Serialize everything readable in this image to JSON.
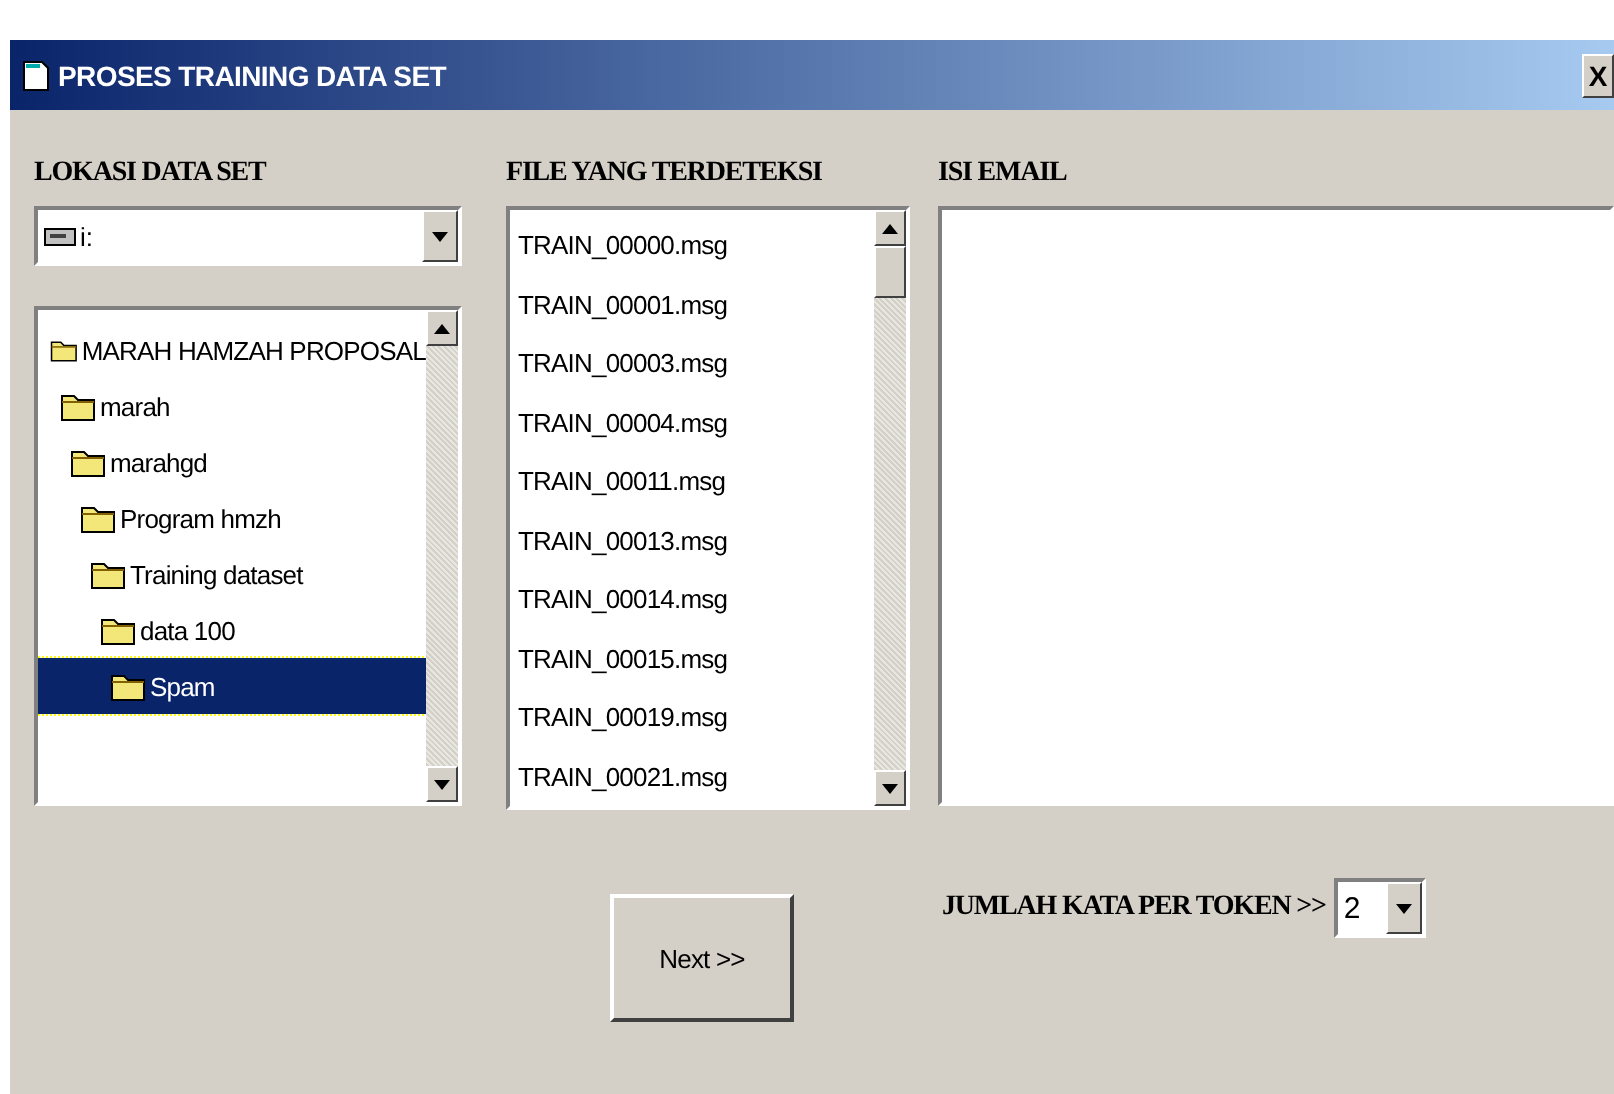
{
  "window": {
    "title": "PROSES TRAINING DATA SET",
    "close": "X"
  },
  "location": {
    "label": "LOKASI DATA SET",
    "drive": {
      "value": "i:"
    },
    "tree": [
      {
        "name": "MARAH HAMZAH PROPOSAL",
        "selected": false,
        "children": [
          {
            "name": "marah",
            "selected": false,
            "children": [
              {
                "name": "marahgd",
                "selected": false,
                "children": [
                  {
                    "name": "Program hmzh",
                    "selected": false,
                    "children": [
                      {
                        "name": "Training dataset",
                        "selected": false,
                        "children": [
                          {
                            "name": "data 100",
                            "selected": false,
                            "children": [
                              {
                                "name": "Spam",
                                "selected": true
                              }
                            ]
                          }
                        ]
                      }
                    ]
                  }
                ]
              }
            ]
          }
        ]
      }
    ]
  },
  "files": {
    "label": "FILE YANG TERDETEKSI",
    "items": [
      "TRAIN_00000.msg",
      "TRAIN_00001.msg",
      "TRAIN_00003.msg",
      "TRAIN_00004.msg",
      "TRAIN_00011.msg",
      "TRAIN_00013.msg",
      "TRAIN_00014.msg",
      "TRAIN_00015.msg",
      "TRAIN_00019.msg",
      "TRAIN_00021.msg"
    ]
  },
  "email": {
    "label": "ISI EMAIL"
  },
  "token": {
    "label": "JUMLAH KATA PER TOKEN >>",
    "value": "2"
  },
  "buttons": [
    {
      "label": "Next >>"
    }
  ]
}
